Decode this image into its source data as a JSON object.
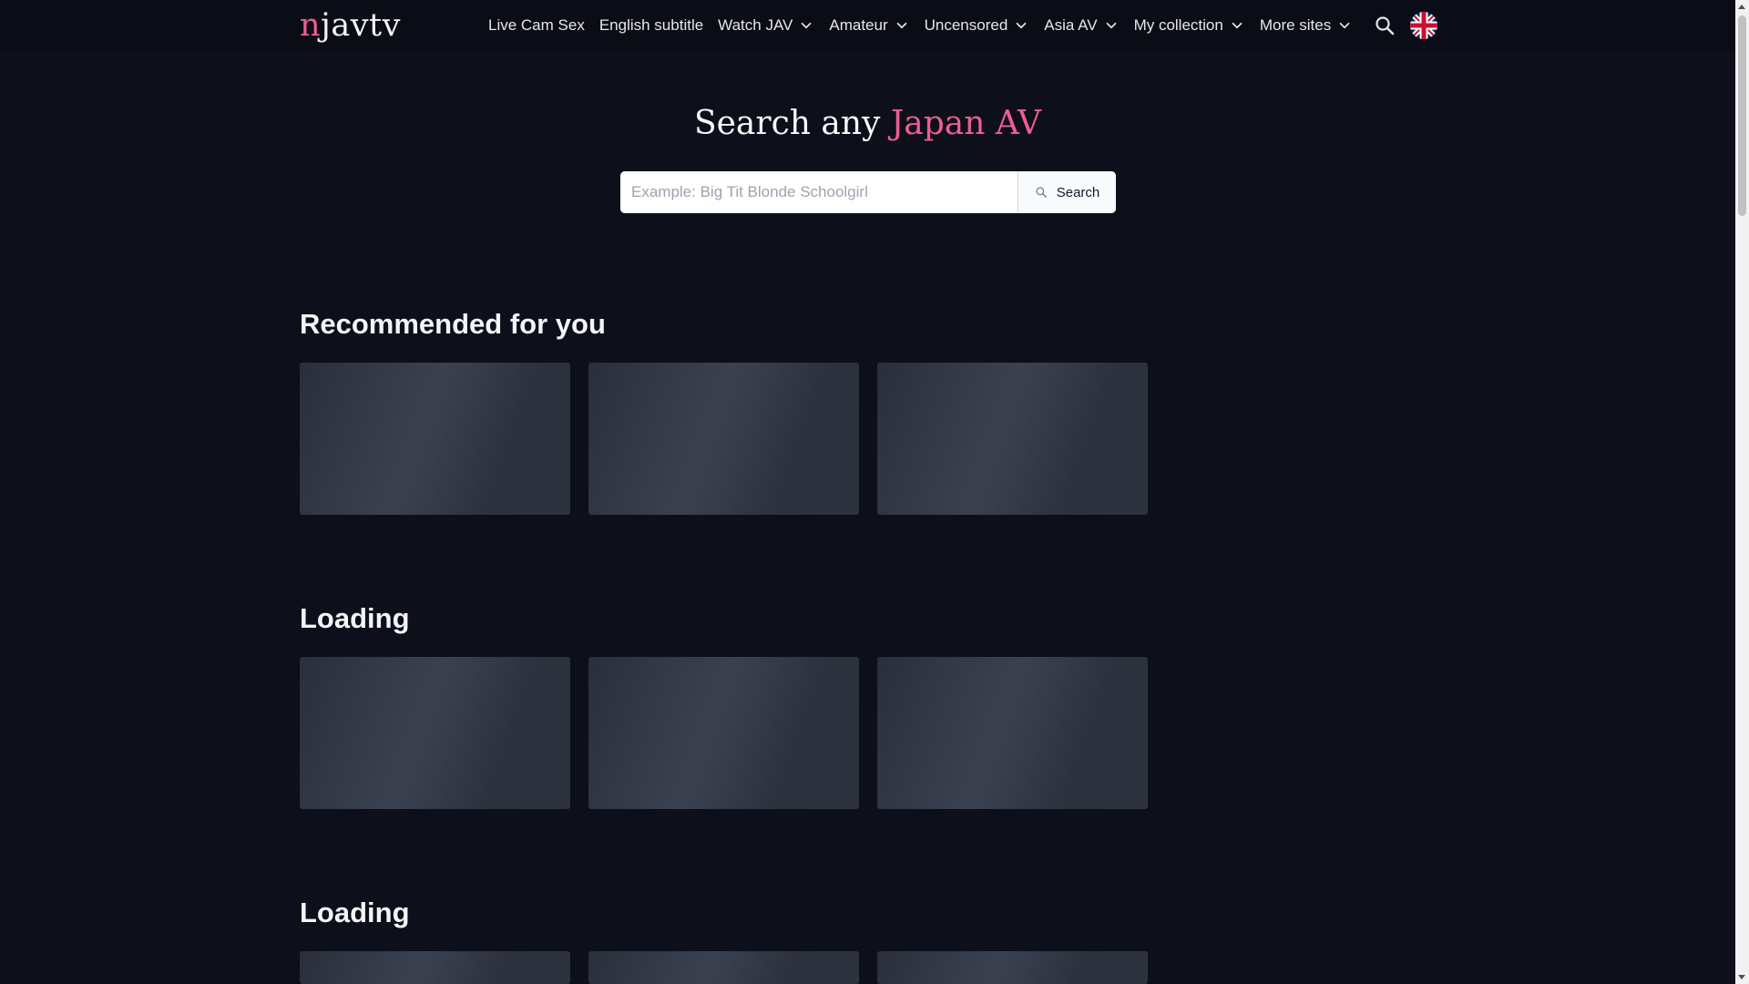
{
  "logo": {
    "first": "n",
    "rest": "javtv"
  },
  "nav": {
    "items": [
      {
        "label": "Live Cam Sex",
        "dropdown": false
      },
      {
        "label": "English subtitle",
        "dropdown": false
      },
      {
        "label": "Watch JAV",
        "dropdown": true
      },
      {
        "label": "Amateur",
        "dropdown": true
      },
      {
        "label": "Uncensored",
        "dropdown": true
      },
      {
        "label": "Asia AV",
        "dropdown": true
      },
      {
        "label": "My collection",
        "dropdown": true
      },
      {
        "label": "More sites",
        "dropdown": true
      }
    ],
    "search_icon": "search-icon",
    "language_icon": "uk-flag-icon"
  },
  "hero": {
    "title_prefix": "Search any ",
    "title_accent": "Japan AV",
    "accent_color": "#ec5f91"
  },
  "search": {
    "value": "",
    "placeholder": "Example: Big Tit Blonde Schoolgirl",
    "button_label": "Search"
  },
  "sections": [
    {
      "title": "Recommended for you",
      "cards": 3
    },
    {
      "title": "Loading",
      "cards": 3
    },
    {
      "title": "Loading",
      "cards": 3
    }
  ]
}
